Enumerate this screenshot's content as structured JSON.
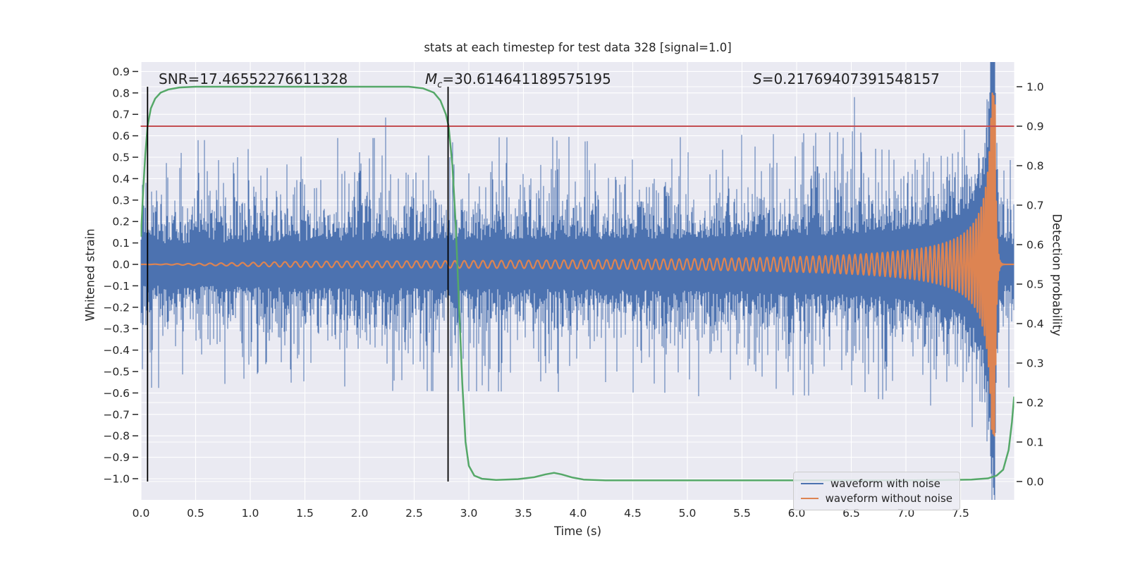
{
  "figure": {
    "title": "stats at each timestep for test data 328 [signal=1.0]",
    "plot_bg": "#eaeaf2",
    "grid_color": "#ffffff",
    "text_color": "#262626"
  },
  "annotations": {
    "snr": "SNR=17.46552276611328",
    "mc_prefix": "M",
    "mc_sub": "c",
    "mc_value": "=30.614641189575195",
    "s_prefix": "S",
    "s_value": "=0.21769407391548157"
  },
  "axes": {
    "x": {
      "label": "Time (s)",
      "tick_values": [
        0,
        0.5,
        1.0,
        1.5,
        2.0,
        2.5,
        3.0,
        3.5,
        4.0,
        4.5,
        5.0,
        5.5,
        6.0,
        6.5,
        7.0,
        7.5
      ],
      "tick_labels": [
        "0.0",
        "0.5",
        "1.0",
        "1.5",
        "2.0",
        "2.5",
        "3.0",
        "3.5",
        "4.0",
        "4.5",
        "5.0",
        "5.5",
        "6.0",
        "6.5",
        "7.0",
        "7.5"
      ],
      "range": [
        0,
        7.99
      ]
    },
    "y_left": {
      "label": "Whitened strain",
      "tick_values": [
        0.9,
        0.8,
        0.7,
        0.6,
        0.5,
        0.4,
        0.3,
        0.2,
        0.1,
        0.0,
        -0.1,
        -0.2,
        -0.3,
        -0.4,
        -0.5,
        -0.6,
        -0.7,
        -0.8,
        -0.9,
        -1.0
      ],
      "tick_labels": [
        "0.9",
        "0.8",
        "0.7",
        "0.6",
        "0.5",
        "0.4",
        "0.3",
        "0.2",
        "0.1",
        "0.0",
        "−0.1",
        "−0.2",
        "−0.3",
        "−0.4",
        "−0.5",
        "−0.6",
        "−0.7",
        "−0.8",
        "−0.9",
        "−1.0"
      ]
    },
    "y_right": {
      "label": "Detection probability",
      "tick_values": [
        1.0,
        0.9,
        0.8,
        0.7,
        0.6,
        0.5,
        0.4,
        0.3,
        0.2,
        0.1,
        0.0
      ],
      "tick_labels": [
        "1.0",
        "0.9",
        "0.8",
        "0.7",
        "0.6",
        "0.5",
        "0.4",
        "0.3",
        "0.2",
        "0.1",
        "0.0"
      ]
    }
  },
  "legend": {
    "items": [
      {
        "label": "waveform with noise",
        "color": "#4c72b0"
      },
      {
        "label": "waveform without noise",
        "color": "#dd8452"
      }
    ]
  },
  "chart_data": {
    "type": "line",
    "title": "stats at each timestep for test data 328 [signal=1.0]",
    "xlabel": "Time (s)",
    "ylabel_left": "Whitened strain",
    "ylabel_right": "Detection probability",
    "xlim": [
      0,
      7.99
    ],
    "ylim_left": [
      -1.1,
      0.94
    ],
    "ylim_right": [
      -0.046,
      1.062
    ],
    "grid": true,
    "threshold_line": {
      "value": 0.9,
      "axis": "right",
      "color": "#c44e52"
    },
    "event_markers": {
      "x_values": [
        0.06,
        2.81
      ],
      "span_right_axis": [
        0.0,
        1.0
      ],
      "color": "#000000"
    },
    "detection_probability": {
      "color": "#55a868",
      "points": [
        [
          0.0,
          0.62
        ],
        [
          0.02,
          0.74
        ],
        [
          0.04,
          0.83
        ],
        [
          0.06,
          0.9
        ],
        [
          0.09,
          0.945
        ],
        [
          0.13,
          0.97
        ],
        [
          0.18,
          0.985
        ],
        [
          0.25,
          0.993
        ],
        [
          0.35,
          0.998
        ],
        [
          0.5,
          1.0
        ],
        [
          2.45,
          1.0
        ],
        [
          2.58,
          0.996
        ],
        [
          2.68,
          0.985
        ],
        [
          2.74,
          0.965
        ],
        [
          2.79,
          0.93
        ],
        [
          2.815,
          0.9
        ],
        [
          2.85,
          0.8
        ],
        [
          2.88,
          0.65
        ],
        [
          2.91,
          0.45
        ],
        [
          2.94,
          0.25
        ],
        [
          2.97,
          0.1
        ],
        [
          3.0,
          0.04
        ],
        [
          3.05,
          0.015
        ],
        [
          3.12,
          0.007
        ],
        [
          3.25,
          0.004
        ],
        [
          3.45,
          0.006
        ],
        [
          3.6,
          0.011
        ],
        [
          3.7,
          0.018
        ],
        [
          3.78,
          0.022
        ],
        [
          3.85,
          0.018
        ],
        [
          3.95,
          0.01
        ],
        [
          4.05,
          0.005
        ],
        [
          4.25,
          0.003
        ],
        [
          5.0,
          0.003
        ],
        [
          6.0,
          0.003
        ],
        [
          7.0,
          0.003
        ],
        [
          7.4,
          0.004
        ],
        [
          7.6,
          0.005
        ],
        [
          7.75,
          0.008
        ],
        [
          7.83,
          0.015
        ],
        [
          7.89,
          0.03
        ],
        [
          7.94,
          0.08
        ],
        [
          7.97,
          0.15
        ],
        [
          7.99,
          0.215
        ]
      ]
    },
    "waveform_without_noise": {
      "color": "#dd8452",
      "merger_time": 7.815,
      "amp_coef": 0.056,
      "amp_exp": -0.76,
      "amp_max": 0.8,
      "freq_coef": 21,
      "freq_exp": -0.375,
      "freq_max": 85,
      "ringdown_tau": 0.012
    },
    "waveform_with_noise": {
      "color": "#4c72b0",
      "noise_core": 0.095,
      "noise_tail": 0.118,
      "seed": 328,
      "spikes_positive": [
        [
          0.35,
          0.45
        ],
        [
          0.75,
          0.38
        ],
        [
          1.15,
          0.45
        ],
        [
          1.4,
          0.36
        ],
        [
          1.95,
          0.43
        ],
        [
          2.35,
          0.4
        ],
        [
          2.82,
          0.5
        ],
        [
          3.15,
          0.36
        ],
        [
          3.55,
          0.37
        ],
        [
          4.1,
          0.44
        ],
        [
          4.62,
          0.36
        ],
        [
          5.2,
          0.42
        ],
        [
          5.55,
          0.36
        ],
        [
          6.05,
          0.57
        ],
        [
          6.45,
          0.38
        ],
        [
          6.95,
          0.4
        ],
        [
          7.45,
          0.43
        ],
        [
          7.74,
          0.77
        ],
        [
          7.79,
          0.97
        ]
      ],
      "spikes_negative": [
        [
          0.55,
          -0.42
        ],
        [
          1.0,
          -0.43
        ],
        [
          1.55,
          -0.46
        ],
        [
          2.2,
          -0.38
        ],
        [
          2.6,
          -0.36
        ],
        [
          3.3,
          -0.46
        ],
        [
          3.75,
          -0.4
        ],
        [
          4.35,
          -0.5
        ],
        [
          4.8,
          -0.42
        ],
        [
          5.1,
          -0.615
        ],
        [
          5.45,
          -0.42
        ],
        [
          5.9,
          -0.44
        ],
        [
          6.3,
          -0.4
        ],
        [
          6.6,
          -0.46
        ],
        [
          7.2,
          -0.46
        ],
        [
          7.55,
          -0.5
        ],
        [
          7.8,
          -0.68
        ]
      ]
    }
  }
}
